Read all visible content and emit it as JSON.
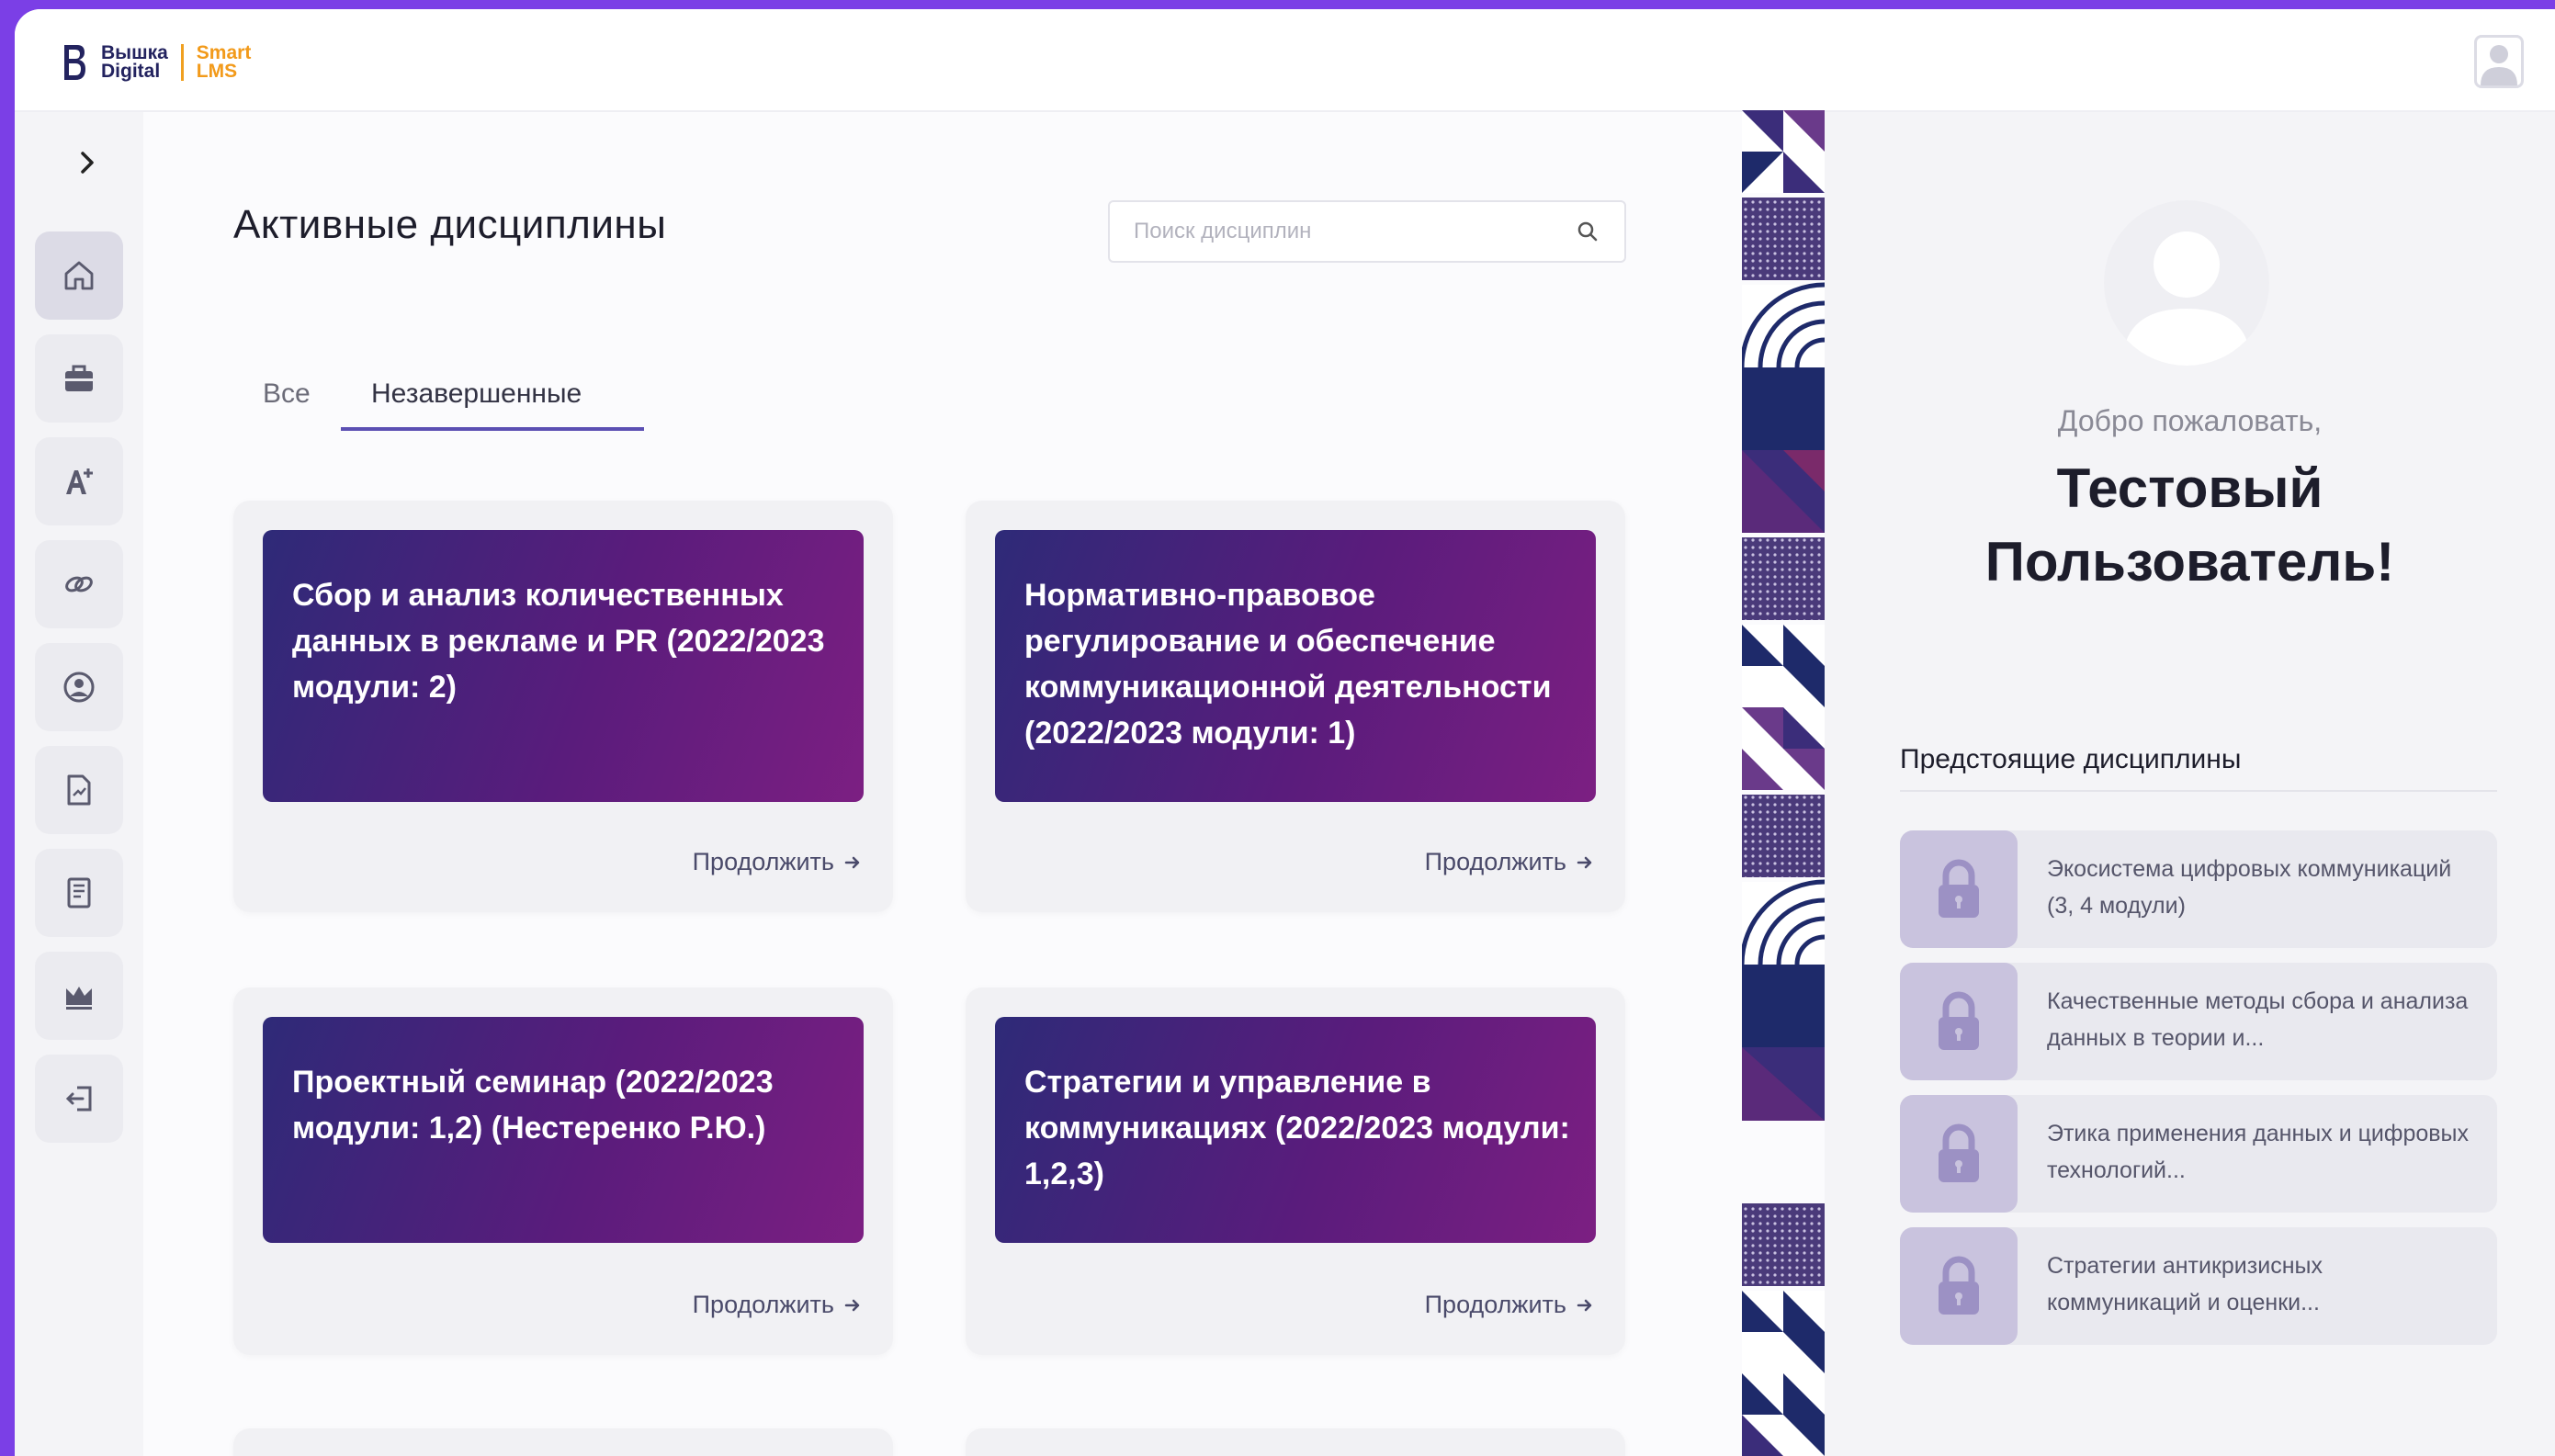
{
  "brand": {
    "line1": "Вышка\nDigital",
    "line2": "Smart\nLMS"
  },
  "main": {
    "title": "Активные дисциплины",
    "search_placeholder": "Поиск дисциплин",
    "tabs": [
      {
        "label": "Все",
        "active": false
      },
      {
        "label": "Незавершенные",
        "active": true
      }
    ],
    "continue_label": "Продолжить",
    "courses": [
      {
        "title": "Сбор и анализ количественных данных в рекламе и PR (2022/2023 модули: 2)"
      },
      {
        "title": "Нормативно-правовое регулирование и обеспечение коммуникационной деятельности (2022/2023 модули: 1)"
      },
      {
        "title": "Проектный семинар (2022/2023 модули: 1,2) (Нестеренко Р.Ю.)"
      },
      {
        "title": "Стратегии и управление в коммуникациях (2022/2023 модули: 1,2,3)"
      }
    ]
  },
  "sidebar": {
    "items": [
      {
        "icon": "home-icon",
        "active": true
      },
      {
        "icon": "briefcase-icon",
        "active": false
      },
      {
        "icon": "grade-icon",
        "active": false
      },
      {
        "icon": "link-icon",
        "active": false
      },
      {
        "icon": "profile-icon",
        "active": false
      },
      {
        "icon": "document-icon",
        "active": false
      },
      {
        "icon": "book-icon",
        "active": false
      },
      {
        "icon": "crown-icon",
        "active": false
      },
      {
        "icon": "logout-icon",
        "active": false
      }
    ]
  },
  "profile": {
    "welcome": "Добро пожаловать,",
    "name": "Тестовый\nПользователь!"
  },
  "upcoming": {
    "title": "Предстоящие дисциплины",
    "items": [
      {
        "title": "Экосистема цифровых коммуникаций (3, 4 модули)"
      },
      {
        "title": "Качественные методы сбора и анализа данных в теории и..."
      },
      {
        "title": "Этика применения данных и цифровых технологий..."
      },
      {
        "title": "Стратегии антикризисных коммуникаций и оценки..."
      }
    ]
  },
  "colors": {
    "accent": "#7b3fe6",
    "banner_start": "#2e2a78",
    "banner_end": "#7c1f82",
    "tab_underline": "#5b4fb3",
    "lock_bg": "#c9c3de"
  }
}
